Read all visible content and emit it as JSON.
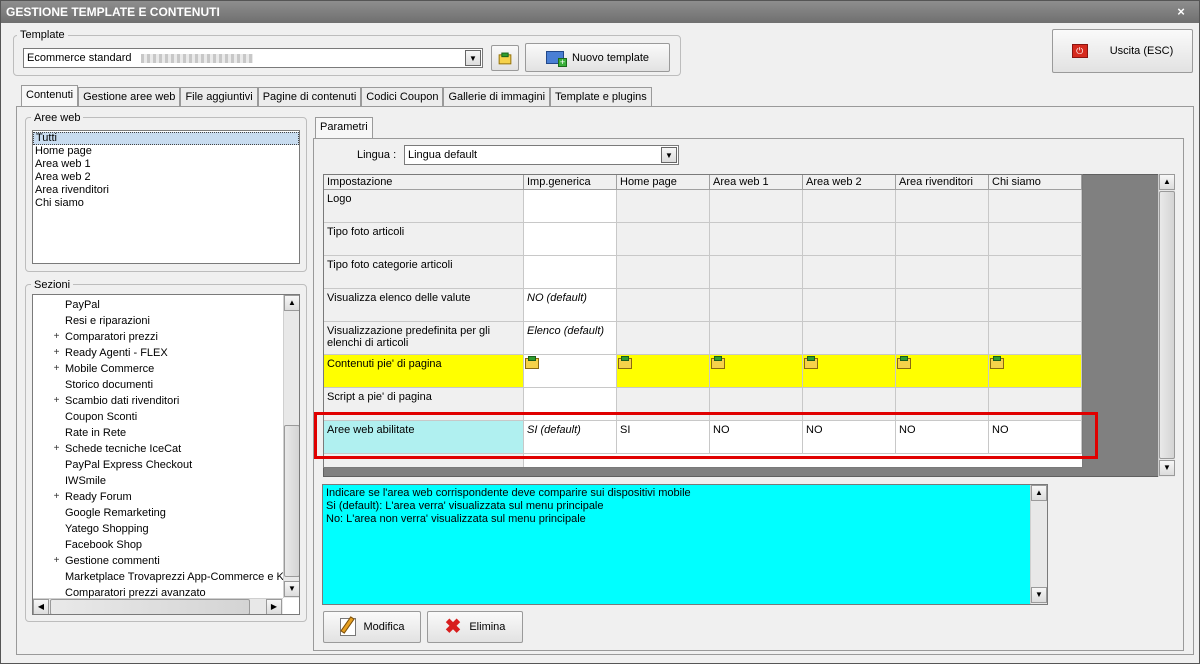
{
  "window": {
    "title": "GESTIONE TEMPLATE E CONTENUTI",
    "close": "×"
  },
  "template": {
    "group_label": "Template",
    "selected": "Ecommerce standard",
    "new_button": "Nuovo template"
  },
  "exit_button": "Uscita (ESC)",
  "tabs": [
    "Contenuti",
    "Gestione aree web",
    "File aggiuntivi",
    "Pagine di contenuti",
    "Codici Coupon",
    "Gallerie di immagini",
    "Template e plugins"
  ],
  "aree_web": {
    "label": "Aree web",
    "items": [
      "Tutti",
      "Home page",
      "Area web 1",
      "Area web 2",
      "Area rivenditori",
      "Chi siamo"
    ]
  },
  "sezioni": {
    "label": "Sezioni",
    "items": [
      {
        "label": "PayPal",
        "expand": false
      },
      {
        "label": "Resi e riparazioni",
        "expand": false
      },
      {
        "label": "Comparatori prezzi",
        "expand": true
      },
      {
        "label": "Ready Agenti - FLEX",
        "expand": true
      },
      {
        "label": "Mobile Commerce",
        "expand": true
      },
      {
        "label": "Storico documenti",
        "expand": false
      },
      {
        "label": "Scambio dati rivenditori",
        "expand": true
      },
      {
        "label": "Coupon Sconti",
        "expand": false
      },
      {
        "label": "Rate in Rete",
        "expand": false
      },
      {
        "label": "Schede tecniche IceCat",
        "expand": true
      },
      {
        "label": "PayPal Express Checkout",
        "expand": false
      },
      {
        "label": "IWSmile",
        "expand": false
      },
      {
        "label": "Ready Forum",
        "expand": true
      },
      {
        "label": "Google Remarketing",
        "expand": false
      },
      {
        "label": "Yatego Shopping",
        "expand": false
      },
      {
        "label": "Facebook Shop",
        "expand": false
      },
      {
        "label": "Gestione commenti",
        "expand": true
      },
      {
        "label": "Marketplace Trovaprezzi App-Commerce e Kir",
        "expand": false
      },
      {
        "label": "Comparatori prezzi avanzato",
        "expand": false
      }
    ]
  },
  "parametri": {
    "tab": "Parametri",
    "lingua_label": "Lingua :",
    "lingua_value": "Lingua default",
    "columns": [
      "Impostazione",
      "Imp.generica",
      "Home page",
      "Area web 1",
      "Area web 2",
      "Area rivenditori",
      "Chi siamo"
    ],
    "rows": [
      {
        "name": "Logo",
        "values": [
          "",
          "",
          "",
          "",
          "",
          ""
        ]
      },
      {
        "name": "Tipo foto articoli",
        "values": [
          "",
          "",
          "",
          "",
          "",
          ""
        ]
      },
      {
        "name": "Tipo foto categorie articoli",
        "values": [
          "",
          "",
          "",
          "",
          "",
          ""
        ]
      },
      {
        "name": "Visualizza elenco delle valute",
        "values": [
          "NO (default)",
          "",
          "",
          "",
          "",
          ""
        ]
      },
      {
        "name": "Visualizzazione predefinita per gli elenchi di articoli",
        "values": [
          "Elenco (default)",
          "",
          "",
          "",
          "",
          ""
        ]
      },
      {
        "name": "Contenuti pie' di pagina",
        "values": [
          "folder-icon",
          "folder-icon",
          "folder-icon",
          "folder-icon",
          "folder-icon",
          "folder-icon"
        ]
      },
      {
        "name": "Script a pie' di pagina",
        "values": [
          "",
          "",
          "",
          "",
          "",
          ""
        ]
      },
      {
        "name": "Aree web abilitate",
        "values": [
          "SI (default)",
          "SI",
          "NO",
          "NO",
          "NO",
          "NO"
        ]
      }
    ],
    "description": [
      "Indicare se l'area web corrispondente deve comparire sui dispositivi mobile",
      "Si (default): L'area verra' visualizzata sul menu principale",
      "No: L'area non verra' visualizzata sul menu principale"
    ]
  },
  "actions": {
    "modifica": "Modifica",
    "elimina": "Elimina"
  },
  "colors": {
    "highlight_row": "#ffff00",
    "selected_cell": "#b0f0f0",
    "description_bg": "#00ffff",
    "callout": "#e00000"
  }
}
